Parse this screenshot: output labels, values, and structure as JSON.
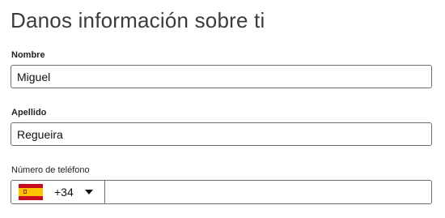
{
  "page": {
    "title": "Danos información sobre ti"
  },
  "form": {
    "first_name": {
      "label": "Nombre",
      "value": "Miguel"
    },
    "last_name": {
      "label": "Apellido",
      "value": "Regueira"
    },
    "phone": {
      "label": "Número de teléfono",
      "country_flag": "spain-flag-icon",
      "dial_code": "+34",
      "value": ""
    }
  }
}
